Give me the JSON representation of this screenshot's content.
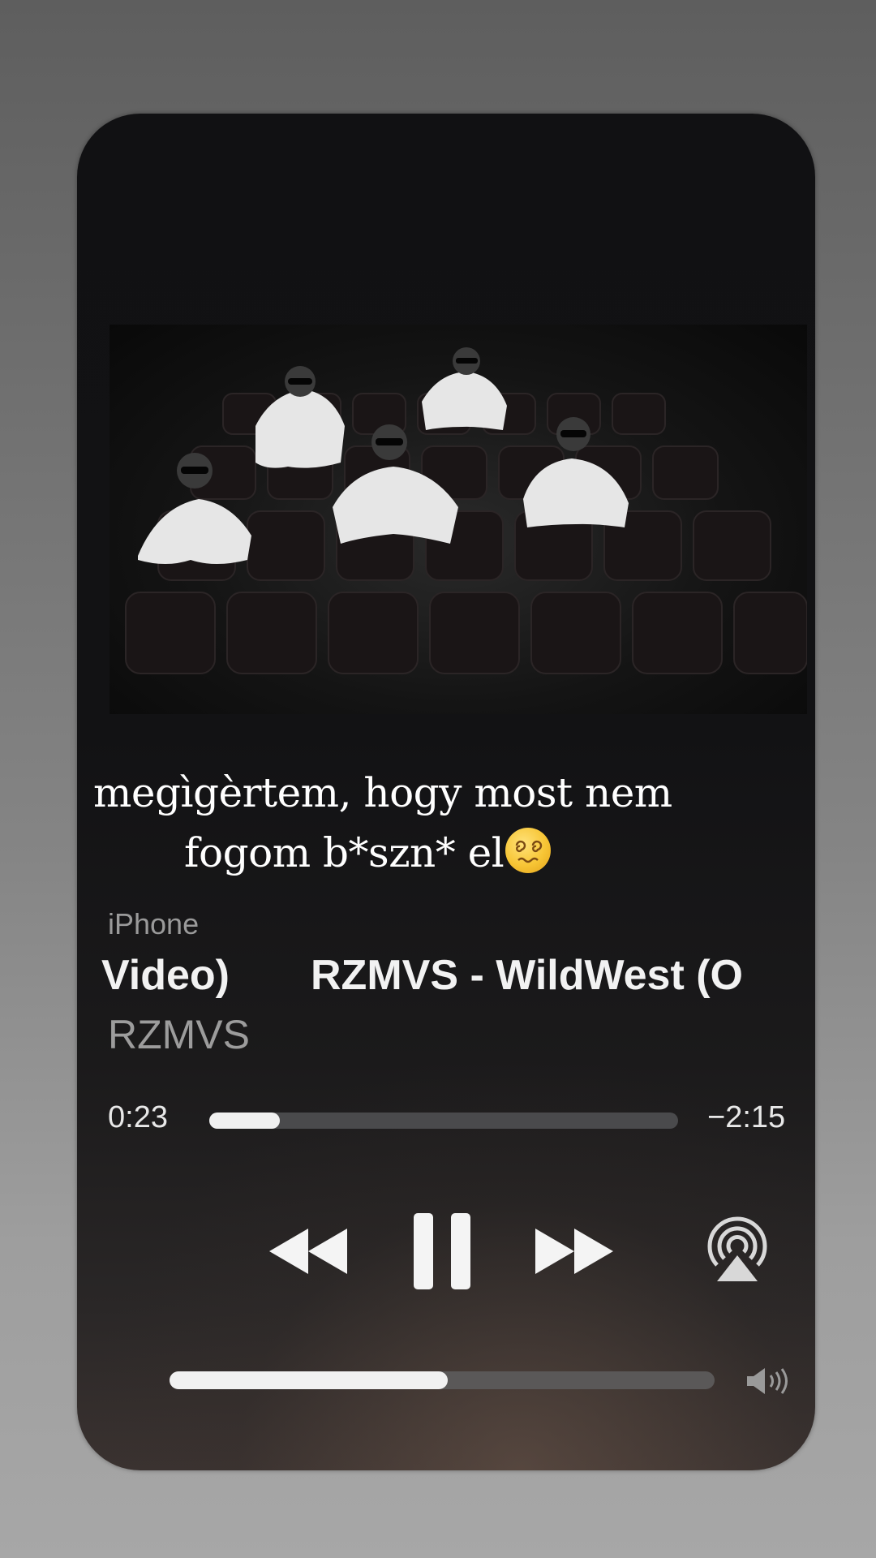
{
  "caption": {
    "line1": "megìgèrtem, hogy most nem",
    "line2": "fogom b*szn* el",
    "emoji": "dizzy-face-emoji"
  },
  "player": {
    "device": "iPhone",
    "title_left": "Video)",
    "title_right": "RZMVS - WildWest (O",
    "artist": "RZMVS",
    "elapsed": "0:23",
    "remaining": "−2:15",
    "progress": 0.15,
    "volume": 0.51
  },
  "controls": {
    "rewind_icon": "rewind-icon",
    "pause_icon": "pause-icon",
    "forward_icon": "fast-forward-icon",
    "airplay_icon": "airplay-icon",
    "volume_low_icon": "speaker-low-icon",
    "volume_high_icon": "speaker-high-icon"
  },
  "artwork": {
    "description_icon": "album-artwork-image"
  }
}
